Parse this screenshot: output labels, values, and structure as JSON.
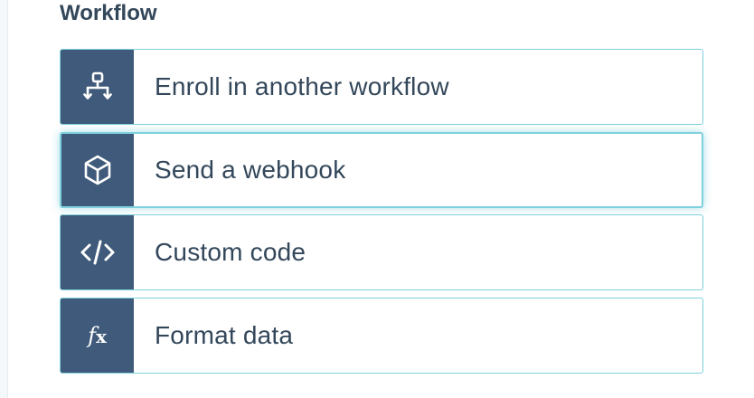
{
  "section": {
    "title": "Workflow"
  },
  "actions": [
    {
      "label": "Enroll in another workflow",
      "icon": "workflow-branch-icon"
    },
    {
      "label": "Send a webhook",
      "icon": "cube-icon"
    },
    {
      "label": "Custom code",
      "icon": "code-icon"
    },
    {
      "label": "Format data",
      "icon": "function-icon",
      "glyph": "f",
      "glyph_suffix": "x"
    }
  ],
  "colors": {
    "icon_background": "#3f5a7a",
    "card_border": "#7fd1de",
    "text": "#33475b"
  }
}
